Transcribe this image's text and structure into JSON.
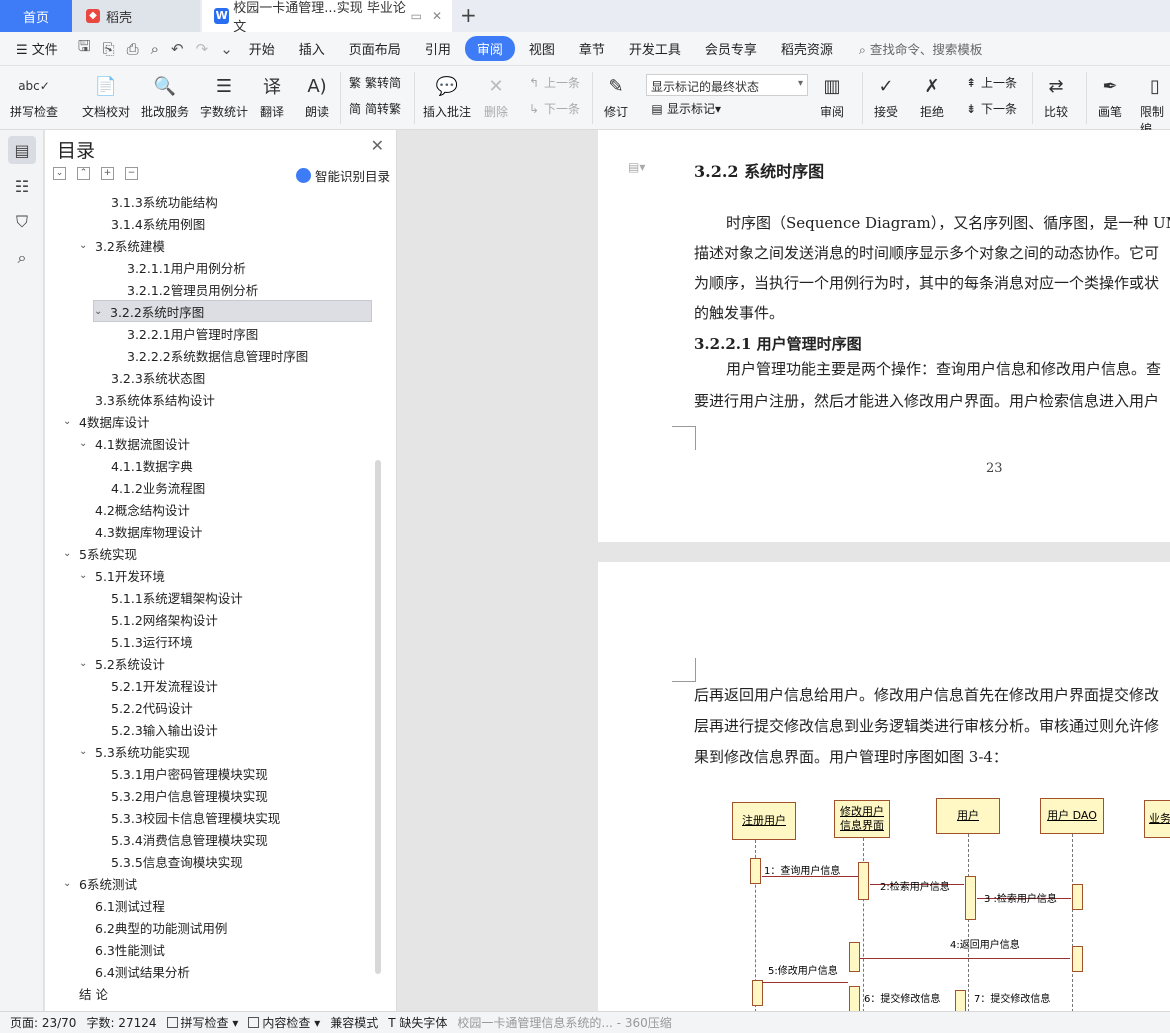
{
  "tabs": {
    "home": "首页",
    "daoke": "稻壳",
    "doc": "校园一卡通管理...实现 毕业论文"
  },
  "menu": {
    "file": "文件",
    "items": [
      "开始",
      "插入",
      "页面布局",
      "引用",
      "审阅",
      "视图",
      "章节",
      "开发工具",
      "会员专享",
      "稻壳资源"
    ],
    "active": "审阅",
    "search": "查找命令、搜索模板"
  },
  "ribbon": {
    "spell": "拼写检查",
    "proofread": "文档校对",
    "review_service": "批改服务",
    "word_count": "字数统计",
    "translate": "翻译",
    "read_aloud": "朗读",
    "to_traditional": "繁转简",
    "to_simplified": "简转繁",
    "insert_comment": "插入批注",
    "delete": "删除",
    "prev": "上一条",
    "next": "下一条",
    "track": "修订",
    "markup_state": "显示标记的最终状态",
    "show_markup": "显示标记",
    "review": "审阅",
    "accept": "接受",
    "reject": "拒绝",
    "prev2": "上一条",
    "next2": "下一条",
    "compare": "比较",
    "pen": "画笔",
    "restrict": "限制编"
  },
  "toc": {
    "title": "目录",
    "smart": "智能识别目录",
    "items": [
      {
        "label": "3.1.3系统功能结构",
        "level": 2,
        "caret": false
      },
      {
        "label": "3.1.4系统用例图",
        "level": 2,
        "caret": false
      },
      {
        "label": "3.2系统建模",
        "level": 1,
        "caret": true
      },
      {
        "label": "3.2.1.1用户用例分析",
        "level": 3,
        "caret": false
      },
      {
        "label": "3.2.1.2管理员用例分析",
        "level": 3,
        "caret": false
      },
      {
        "label": "3.2.2系统时序图",
        "level": 2,
        "caret": true,
        "selected": true
      },
      {
        "label": "3.2.2.1用户管理时序图",
        "level": 3,
        "caret": false
      },
      {
        "label": "3.2.2.2系统数据信息管理时序图",
        "level": 3,
        "caret": false
      },
      {
        "label": "3.2.3系统状态图",
        "level": 2,
        "caret": false
      },
      {
        "label": "3.3系统体系结构设计",
        "level": 1,
        "caret": false
      },
      {
        "label": "4数据库设计",
        "level": 0,
        "caret": true
      },
      {
        "label": "4.1数据流图设计",
        "level": 1,
        "caret": true
      },
      {
        "label": "4.1.1数据字典",
        "level": 2,
        "caret": false
      },
      {
        "label": "4.1.2业务流程图",
        "level": 2,
        "caret": false
      },
      {
        "label": "4.2概念结构设计",
        "level": 1,
        "caret": false
      },
      {
        "label": "4.3数据库物理设计",
        "level": 1,
        "caret": false
      },
      {
        "label": "5系统实现",
        "level": 0,
        "caret": true
      },
      {
        "label": "5.1开发环境",
        "level": 1,
        "caret": true
      },
      {
        "label": "5.1.1系统逻辑架构设计",
        "level": 2,
        "caret": false
      },
      {
        "label": "5.1.2网络架构设计",
        "level": 2,
        "caret": false
      },
      {
        "label": "5.1.3运行环境",
        "level": 2,
        "caret": false
      },
      {
        "label": "5.2系统设计",
        "level": 1,
        "caret": true
      },
      {
        "label": "5.2.1开发流程设计",
        "level": 2,
        "caret": false
      },
      {
        "label": "5.2.2代码设计",
        "level": 2,
        "caret": false
      },
      {
        "label": "5.2.3输入输出设计",
        "level": 2,
        "caret": false
      },
      {
        "label": "5.3系统功能实现",
        "level": 1,
        "caret": true
      },
      {
        "label": "5.3.1用户密码管理模块实现",
        "level": 2,
        "caret": false
      },
      {
        "label": "5.3.2用户信息管理模块实现",
        "level": 2,
        "caret": false
      },
      {
        "label": "5.3.3校园卡信息管理模块实现",
        "level": 2,
        "caret": false
      },
      {
        "label": "5.3.4消费信息管理模块实现",
        "level": 2,
        "caret": false
      },
      {
        "label": "5.3.5信息查询模块实现",
        "level": 2,
        "caret": false
      },
      {
        "label": "6系统测试",
        "level": 0,
        "caret": true
      },
      {
        "label": "6.1测试过程",
        "level": 1,
        "caret": false
      },
      {
        "label": "6.2典型的功能测试用例",
        "level": 1,
        "caret": false
      },
      {
        "label": "6.3性能测试",
        "level": 1,
        "caret": false
      },
      {
        "label": "6.4测试结果分析",
        "level": 1,
        "caret": false
      },
      {
        "label": "结  论",
        "level": 0,
        "caret": false
      }
    ]
  },
  "page1": {
    "heading": "3.2.2  系统时序图",
    "lines": [
      "时序图（Sequence Diagram），又名序列图、循序图，是一种 UML",
      "描述对象之间发送消息的时间顺序显示多个对象之间的动态协作。它可",
      "为顺序，当执行一个用例行为时，其中的每条消息对应一个类操作或状",
      "的触发事件。",
      "3.2.2.1   用户管理时序图",
      "用户管理功能主要是两个操作：查询用户信息和修改用户信息。查",
      "要进行用户注册，然后才能进入修改用户界面。用户检索信息进入用户"
    ],
    "page_number": "23"
  },
  "page2": {
    "lines": [
      "后再返回用户信息给用户。修改用户信息首先在修改用户界面提交修改",
      "层再进行提交修改信息到业务逻辑类进行审核分析。审核通过则允许修",
      "果到修改信息界面。用户管理时序图如图  3-4："
    ],
    "diagram": {
      "actors": [
        "注册用户",
        "修改用户信息界面",
        "用户",
        "用户 DAO",
        "业务"
      ],
      "messages": [
        "1：查询用户信息",
        "2:检索用户信息",
        "3 :检索用户信息",
        "4:返回用户信息",
        "5:修改用户信息",
        "6：提交修改信息",
        "7：提交修改信息"
      ]
    }
  },
  "status": {
    "page": "页面: 23/70",
    "words": "字数: 27124",
    "spell": "拼写检查",
    "content": "内容检查",
    "compat": "兼容模式",
    "missing_font": "缺失字体",
    "tip": "校园一卡通管理信息系统的... - 360压缩"
  }
}
